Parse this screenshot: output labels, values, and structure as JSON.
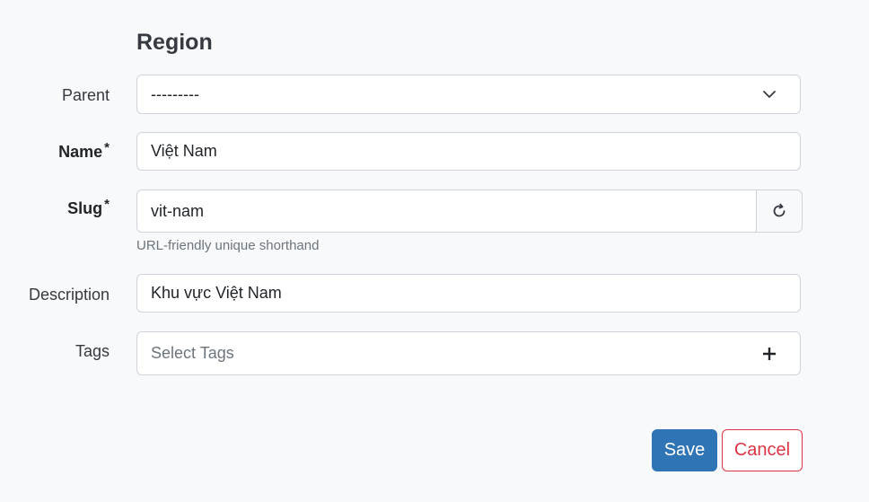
{
  "section": {
    "title": "Region"
  },
  "fields": {
    "parent": {
      "label": "Parent",
      "value": "---------",
      "icon": "chevron-down-icon"
    },
    "name": {
      "label": "Name",
      "required_mark": "*",
      "value": "Việt Nam"
    },
    "slug": {
      "label": "Slug",
      "required_mark": "*",
      "value": "vit-nam",
      "help_text": "URL-friendly unique shorthand",
      "regenerate_icon": "refresh-icon"
    },
    "description": {
      "label": "Description",
      "value": "Khu vực Việt Nam"
    },
    "tags": {
      "label": "Tags",
      "placeholder": "Select Tags",
      "icon": "plus-icon"
    }
  },
  "actions": {
    "save_label": "Save",
    "cancel_label": "Cancel"
  },
  "colors": {
    "primary": "#2f74b5",
    "danger": "#dc3545",
    "background": "#f8f9fa",
    "border": "#ced4da"
  }
}
